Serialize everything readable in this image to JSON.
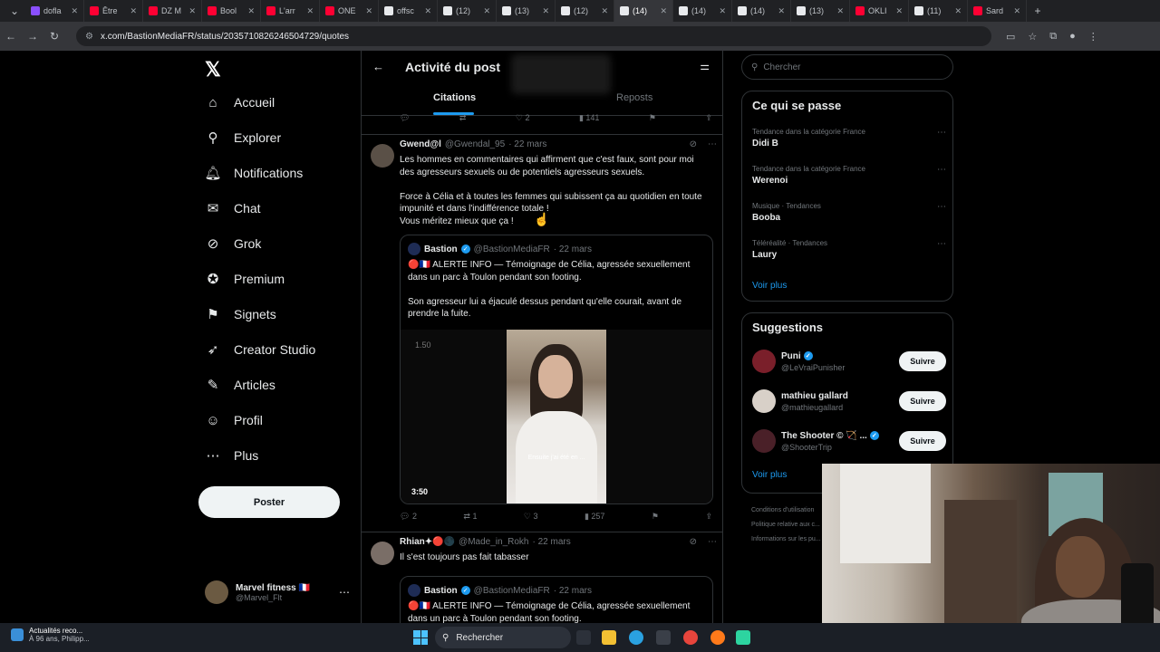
{
  "browser": {
    "tabs": [
      {
        "label": "dofla",
        "color": "#8a4fff"
      },
      {
        "label": "Être",
        "color": "#ff0033"
      },
      {
        "label": "DZ M",
        "color": "#ff0033"
      },
      {
        "label": "Bool",
        "color": "#ff0033"
      },
      {
        "label": "L'arr",
        "color": "#ff0033"
      },
      {
        "label": "ONE",
        "color": "#ff0033"
      },
      {
        "label": "offsc",
        "color": "#000000"
      },
      {
        "label": "(12)",
        "color": "#000000"
      },
      {
        "label": "(13)",
        "color": "#000000"
      },
      {
        "label": "(12)",
        "color": "#000000"
      },
      {
        "label": "(14)",
        "color": "#000000",
        "active": true
      },
      {
        "label": "(14)",
        "color": "#000000"
      },
      {
        "label": "(14)",
        "color": "#000000"
      },
      {
        "label": "(13)",
        "color": "#000000"
      },
      {
        "label": "OKLI",
        "color": "#ff0033"
      },
      {
        "label": "(11)",
        "color": "#000000"
      },
      {
        "label": "Sard",
        "color": "#ff0033"
      }
    ],
    "url": "x.com/BastionMediaFR/status/2035710826246504729/quotes"
  },
  "sidebar": {
    "items": [
      {
        "label": "Accueil",
        "icon": "home-icon",
        "glyph": "⌂"
      },
      {
        "label": "Explorer",
        "icon": "search-icon",
        "glyph": "⚲"
      },
      {
        "label": "Notifications",
        "icon": "bell-icon",
        "glyph": "🔔︎",
        "badge": "14"
      },
      {
        "label": "Chat",
        "icon": "mail-icon",
        "glyph": "✉"
      },
      {
        "label": "Grok",
        "icon": "grok-icon",
        "glyph": "⊘"
      },
      {
        "label": "Premium",
        "icon": "premium-icon",
        "glyph": "✪"
      },
      {
        "label": "Signets",
        "icon": "bookmark-icon",
        "glyph": "⚑"
      },
      {
        "label": "Creator Studio",
        "icon": "rocket-icon",
        "glyph": "➶"
      },
      {
        "label": "Articles",
        "icon": "article-icon",
        "glyph": "✎"
      },
      {
        "label": "Profil",
        "icon": "user-icon",
        "glyph": "☺"
      },
      {
        "label": "Plus",
        "icon": "more-icon",
        "glyph": "⋯"
      }
    ],
    "post_button": "Poster",
    "account": {
      "name": "Marvel fitness 🇫🇷",
      "handle": "@Marvel_Flt"
    }
  },
  "main": {
    "title": "Activité du post",
    "tabs": [
      "Citations",
      "Reposts"
    ],
    "prev_actions": {
      "likes": "2",
      "views": "141"
    },
    "tweets": [
      {
        "name": "Gwend@l",
        "handle": "@Gwendal_95",
        "time": "· 22 mars",
        "text": [
          "Les hommes en commentaires qui affirment que c'est faux, sont pour moi",
          "des agresseurs sexuels ou de potentiels agresseurs sexuels.",
          "",
          "Force à Célia et à toutes les femmes qui subissent ça au quotidien en toute",
          "impunité et dans l'indifférence totale !",
          "Vous méritez mieux que ça !"
        ],
        "quote": {
          "name": "Bastion",
          "handle": "@BastionMediaFR",
          "time": "· 22 mars",
          "text": [
            "🔴🇫🇷 ALERTE INFO — Témoignage de Célia, agressée sexuellement",
            "dans un parc à Toulon pendant son footing.",
            "",
            "Son agresseur lui a éjaculé dessus pendant qu'elle courait, avant de",
            "prendre la fuite."
          ],
          "video": {
            "duration": "3:50",
            "rate": "1.50",
            "subtitle": "Ensuite j'ai été en ..."
          }
        },
        "stats": {
          "replies": "2",
          "reposts": "1",
          "likes": "3",
          "views": "257"
        }
      },
      {
        "name": "Rhian✦🔴🌑",
        "handle": "@Made_in_Rokh",
        "time": "· 22 mars",
        "text": [
          "Il s'est toujours pas fait tabasser"
        ],
        "quote": {
          "name": "Bastion",
          "handle": "@BastionMediaFR",
          "time": "· 22 mars",
          "text": [
            "🔴🇫🇷 ALERTE INFO — Témoignage de Célia, agressée sexuellement",
            "dans un parc à Toulon pendant son footing."
          ]
        }
      }
    ]
  },
  "right": {
    "search_placeholder": "Chercher",
    "trends_title": "Ce qui se passe",
    "trends": [
      {
        "context": "Tendance dans la catégorie France",
        "name": "Didi B"
      },
      {
        "context": "Tendance dans la catégorie France",
        "name": "Werenoi"
      },
      {
        "context": "Musique · Tendances",
        "name": "Booba"
      },
      {
        "context": "Téléréalité · Tendances",
        "name": "Laury"
      }
    ],
    "show_more": "Voir plus",
    "suggestions_title": "Suggestions",
    "suggestions": [
      {
        "name": "Puni",
        "handle": "@LeVraiPunisher",
        "verified": true
      },
      {
        "name": "mathieu gallard",
        "handle": "@mathieugallard",
        "verified": false
      },
      {
        "name": "The Shooter © 🏹 ...",
        "handle": "@ShooterTrip",
        "verified": true
      }
    ],
    "follow_label": "Suivre",
    "footer": [
      "Conditions d'utilisation",
      "Politique relative aux c...",
      "Informations sur les pu..."
    ]
  },
  "taskbar": {
    "news_title": "Actualités reco...",
    "news_sub": "À 96 ans, Philipp...",
    "search": "Rechercher"
  },
  "colors": {
    "accent": "#1d9bf0",
    "background": "#000000",
    "border": "#2f3336",
    "muted": "#71767b"
  }
}
